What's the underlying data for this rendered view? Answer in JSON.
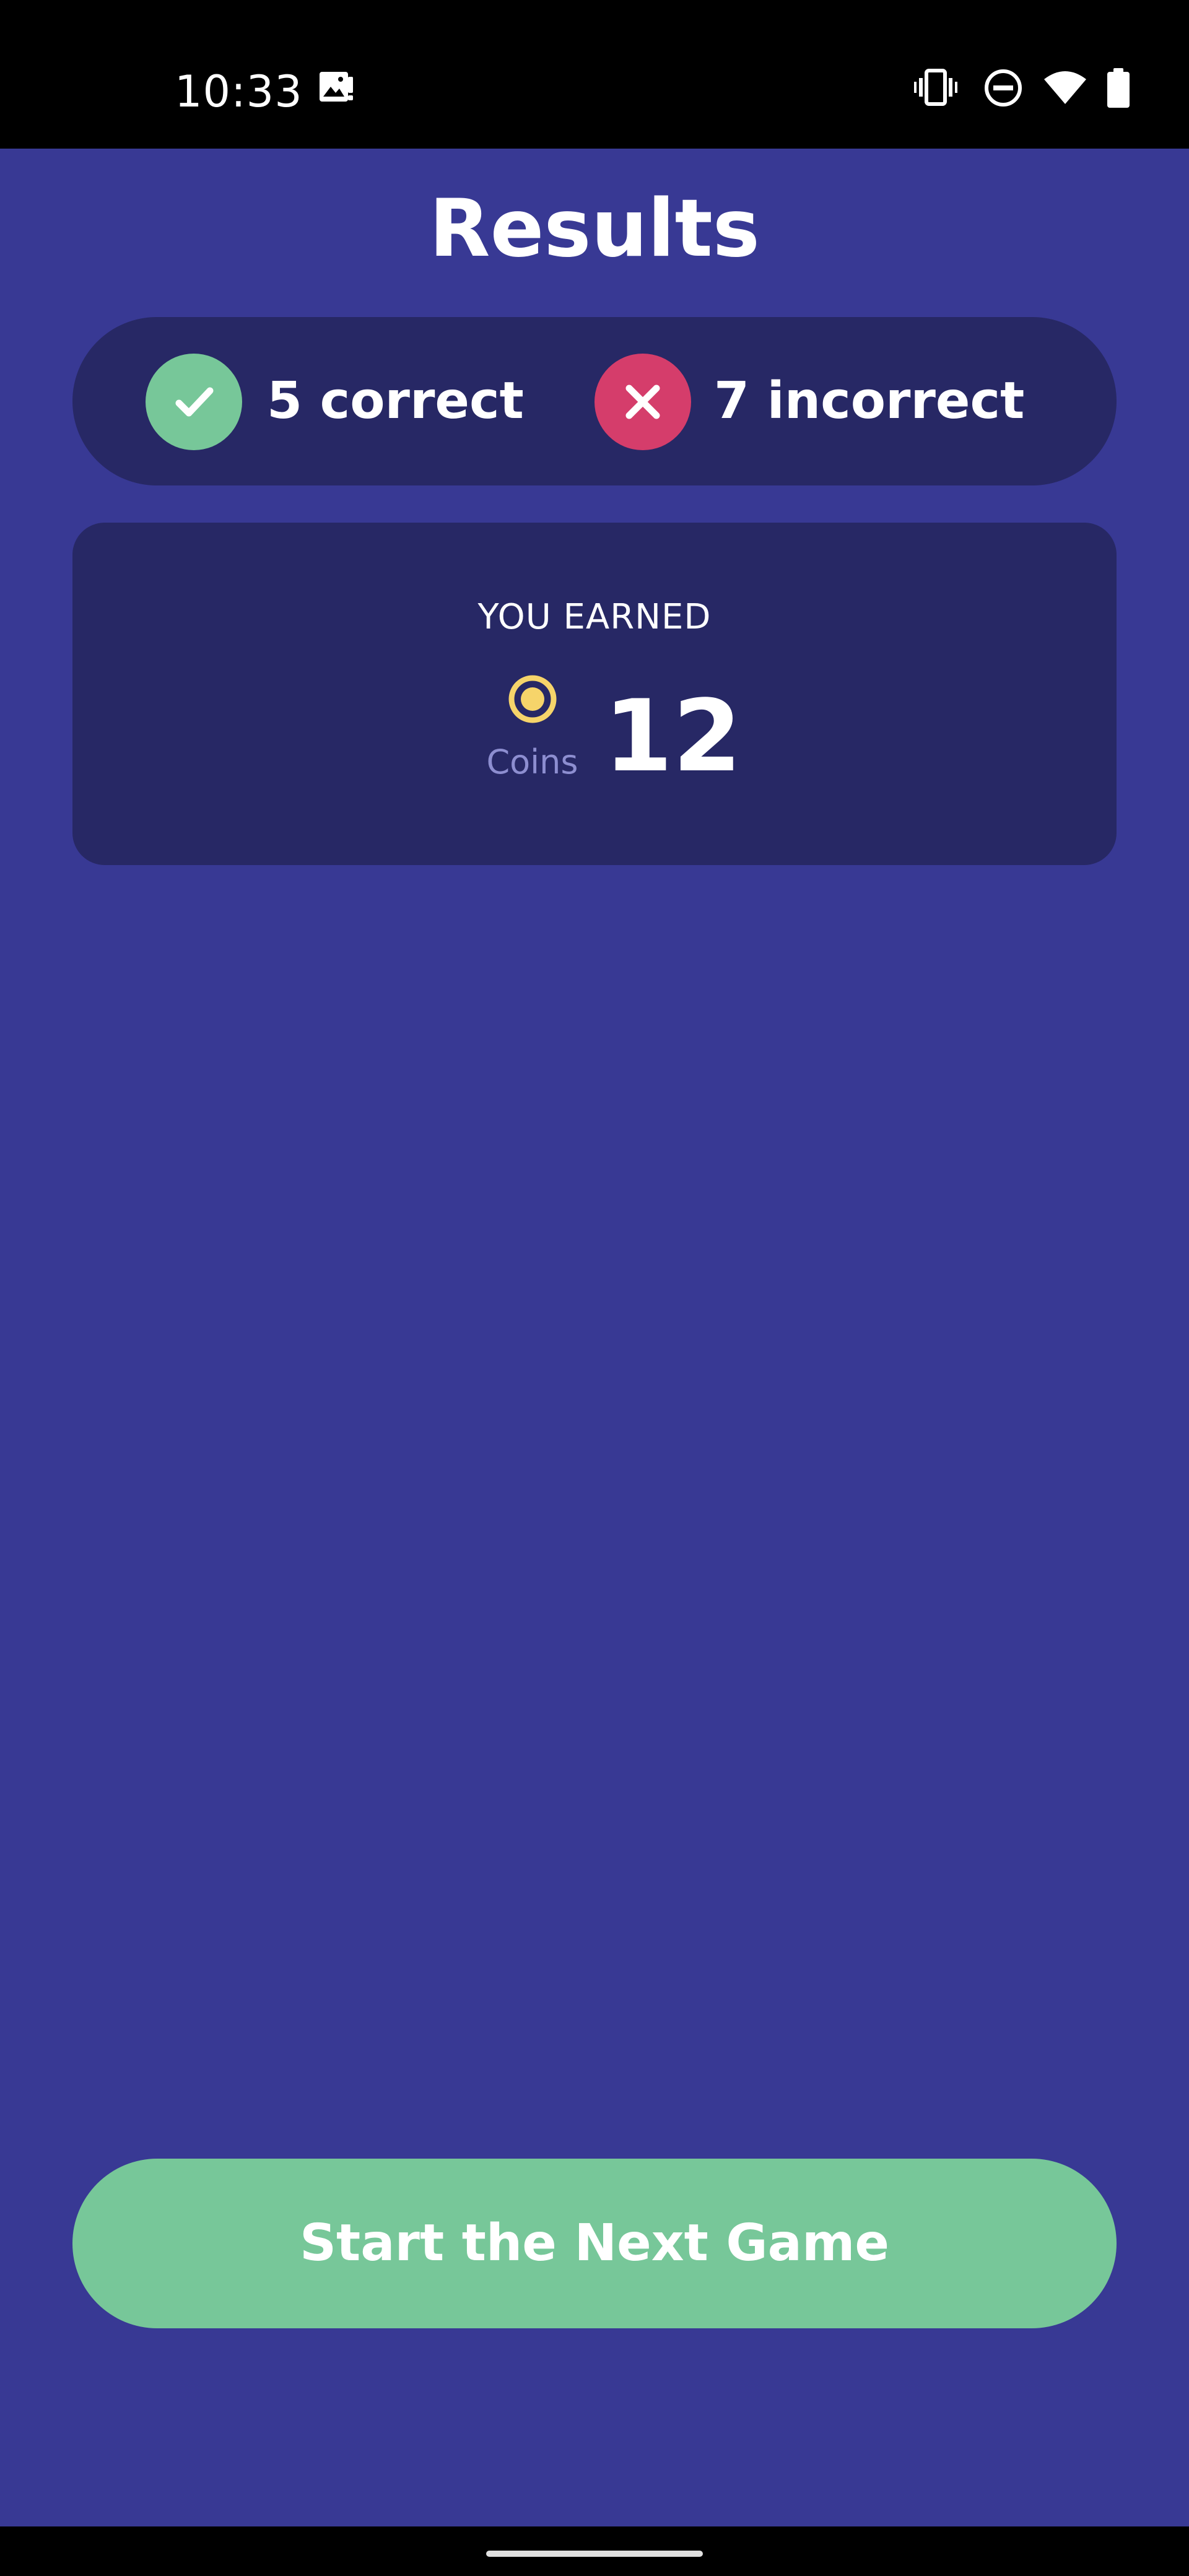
{
  "status_bar": {
    "time": "10:33",
    "icons": [
      "image-notification-icon",
      "vibrate-icon",
      "do-not-disturb-icon",
      "wifi-icon",
      "battery-icon"
    ]
  },
  "header": {
    "title": "Results"
  },
  "score": {
    "correct_text": "5 correct",
    "incorrect_text": "7 incorrect",
    "correct_icon": "check-icon",
    "incorrect_icon": "close-icon"
  },
  "earned": {
    "label": "YOU EARNED",
    "currency_label": "Coins",
    "amount": "12",
    "currency_icon": "coin-icon"
  },
  "actions": {
    "next_game_label": "Start the Next Game"
  },
  "colors": {
    "background": "#383994",
    "card": "#272865",
    "correct": "#77c799",
    "incorrect": "#d53d6b",
    "coin": "#f6d46a",
    "coins_label": "#8d8ed0",
    "button": "#77c799"
  }
}
